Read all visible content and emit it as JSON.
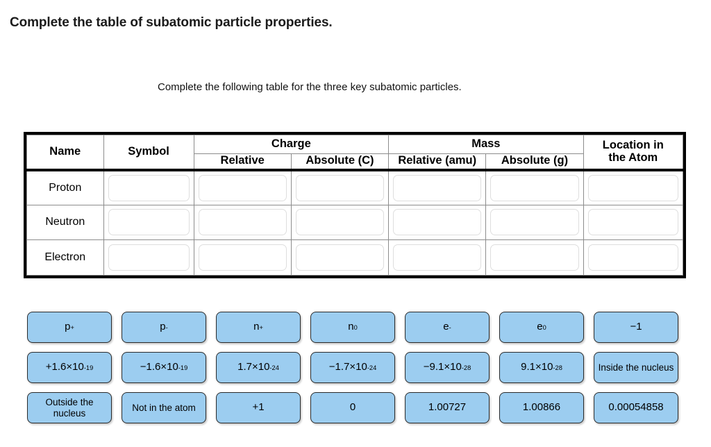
{
  "question": {
    "title": "Complete the table of subatomic particle properties.",
    "instruction": "Complete the following table for the three key subatomic particles."
  },
  "table": {
    "headers": {
      "name": "Name",
      "symbol": "Symbol",
      "charge_group": "Charge",
      "charge_relative": "Relative",
      "charge_absolute": "Absolute (C)",
      "mass_group": "Mass",
      "mass_relative": "Relative (amu)",
      "mass_absolute": "Absolute (g)",
      "location_line1": "Location in",
      "location_line2": "the Atom"
    },
    "rows": [
      {
        "name": "Proton"
      },
      {
        "name": "Neutron"
      },
      {
        "name": "Electron"
      }
    ],
    "dropzone_columns": [
      "symbol",
      "charge_relative",
      "charge_absolute",
      "mass_relative",
      "mass_absolute",
      "location"
    ]
  },
  "answer_bank": {
    "rows": [
      [
        {
          "base": "p",
          "sup": "+",
          "multiline": false
        },
        {
          "base": "p",
          "sup": "-",
          "multiline": false
        },
        {
          "base": "n",
          "sup": "+",
          "multiline": false
        },
        {
          "base": "n",
          "sup": "0",
          "multiline": false
        },
        {
          "base": "e",
          "sup": "-",
          "multiline": false
        },
        {
          "base": "e",
          "sup": "0",
          "multiline": false
        },
        {
          "base": "−1",
          "sup": "",
          "multiline": false
        }
      ],
      [
        {
          "base": "+1.6×10",
          "sup": "-19",
          "multiline": false
        },
        {
          "base": "−1.6×10",
          "sup": "-19",
          "multiline": false
        },
        {
          "base": "1.7×10",
          "sup": "-24",
          "multiline": false
        },
        {
          "base": "−1.7×10",
          "sup": "-24",
          "multiline": false
        },
        {
          "base": "−9.1×10",
          "sup": "-28",
          "multiline": false
        },
        {
          "base": "9.1×10",
          "sup": "-28",
          "multiline": false
        },
        {
          "base": "Inside the nucleus",
          "sup": "",
          "multiline": true
        }
      ],
      [
        {
          "base": "Outside the nucleus",
          "sup": "",
          "multiline": true
        },
        {
          "base": "Not in the atom",
          "sup": "",
          "multiline": true
        },
        {
          "base": "+1",
          "sup": "",
          "multiline": false
        },
        {
          "base": "0",
          "sup": "",
          "multiline": false
        },
        {
          "base": "1.00727",
          "sup": "",
          "multiline": false
        },
        {
          "base": "1.00866",
          "sup": "",
          "multiline": false
        },
        {
          "base": "0.00054858",
          "sup": "",
          "multiline": false
        }
      ]
    ]
  },
  "colors": {
    "tile_fill": "#9ccdf0",
    "tile_border": "#2a2a2a",
    "table_border": "#000000",
    "dropzone_border": "#dedede",
    "page_background": "#ffffff"
  }
}
